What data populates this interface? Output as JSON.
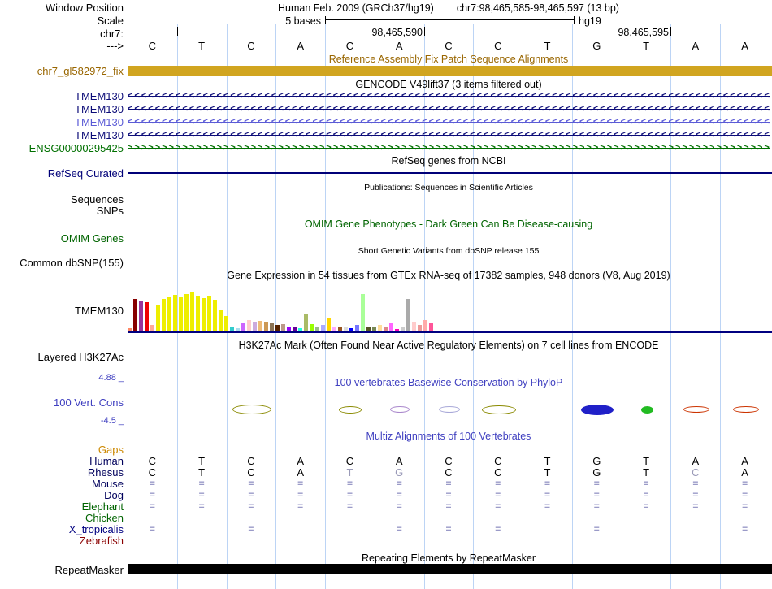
{
  "window": {
    "position_label": "Window Position",
    "assembly_title": "Human Feb. 2009 (GRCh37/hg19)",
    "position_title": "chr7:98,465,585-98,465,597 (13 bp)"
  },
  "ruler": {
    "scale_label": "Scale",
    "scale_text": "5 bases",
    "genome_build": "hg19",
    "chrom_label": "chr7:",
    "coord_ticks": [
      "98,465,590",
      "98,465,595"
    ],
    "strand_arrow": "--->",
    "bases": [
      "C",
      "T",
      "C",
      "A",
      "C",
      "A",
      "C",
      "C",
      "T",
      "G",
      "T",
      "A",
      "A"
    ]
  },
  "grid_color": "#bcd4f5",
  "tracks": {
    "fix_patch": {
      "header": "Reference Assembly Fix Patch Sequence Alignments",
      "label": "chr7_gl582972_fix",
      "bar_color": "#d1a520",
      "text_color": "#996600"
    },
    "gencode": {
      "header": "GENCODE V49lift37 (3 items filtered out)",
      "items": [
        {
          "label": "TMEM130",
          "color": "#0c0c78",
          "arrow": "<"
        },
        {
          "label": "TMEM130",
          "color": "#0c0c78",
          "arrow": "<"
        },
        {
          "label": "TMEM130",
          "color": "#5b5bd6",
          "arrow": "<"
        },
        {
          "label": "TMEM130",
          "color": "#0c0c78",
          "arrow": "<"
        },
        {
          "label": "ENSG00000295425",
          "color": "#007000",
          "arrow": ">"
        }
      ]
    },
    "refseq": {
      "header": "RefSeq genes from NCBI",
      "label": "RefSeq Curated",
      "color": "#000078"
    },
    "publications": {
      "header": "Publications: Sequences in Scientific Articles",
      "labels": [
        "Sequences",
        "SNPs"
      ]
    },
    "omim": {
      "header": "OMIM Gene Phenotypes - Dark Green Can Be Disease-causing",
      "label": "OMIM Genes",
      "color": "#006400"
    },
    "dbsnp": {
      "header": "Short Genetic Variants from dbSNP release 155",
      "label": "Common dbSNP(155)"
    },
    "gtex": {
      "header": "Gene Expression in 54 tissues from GTEx RNA-seq of 17382 samples, 948 donors (V8, Aug 2019)",
      "label": "TMEM130",
      "baseline_color": "#000080"
    },
    "h3k27ac": {
      "header": "H3K27Ac Mark (Often Found Near Active Regulatory Elements) on 7 cell lines from ENCODE",
      "label": "Layered H3K27Ac"
    },
    "phylop": {
      "header": "100 vertebrates Basewise Conservation by PhyloP",
      "label": "100 Vert. Cons",
      "scale_max": "4.88 _",
      "scale_min": "-4.5 _",
      "accent_color": "#4040c0",
      "marks": [
        {
          "col": 2,
          "w": 46,
          "h": 10,
          "color": "#8a8a00",
          "fill": false
        },
        {
          "col": 4,
          "w": 26,
          "h": 7,
          "color": "#8a8a00",
          "fill": false
        },
        {
          "col": 5,
          "w": 22,
          "h": 6,
          "color": "#aa88cc",
          "fill": false
        },
        {
          "col": 6,
          "w": 24,
          "h": 6,
          "color": "#a8a8d8",
          "fill": false
        },
        {
          "col": 7,
          "w": 40,
          "h": 9,
          "color": "#8a8a00",
          "fill": false
        },
        {
          "col": 9,
          "w": 38,
          "h": 11,
          "color": "#2020c8",
          "fill": true
        },
        {
          "col": 10,
          "w": 13,
          "h": 7,
          "color": "#22bb22",
          "fill": true
        },
        {
          "col": 11,
          "w": 30,
          "h": 6,
          "color": "#cc3300",
          "fill": false
        },
        {
          "col": 12,
          "w": 30,
          "h": 6,
          "color": "#cc3300",
          "fill": false
        }
      ]
    },
    "multiz": {
      "header": "Multiz Alignments of 100 Vertebrates",
      "accent_color": "#4040c0",
      "eq_color": "#9a9ac8",
      "dim_color": "#9a9ab8",
      "rows": [
        {
          "label": "Gaps",
          "label_color": "#cc8800",
          "cells": [
            "",
            "",
            "",
            "",
            "",
            "",
            "",
            "",
            "",
            "",
            "",
            "",
            ""
          ]
        },
        {
          "label": "Human",
          "label_color": "#00005c",
          "cells": [
            "C",
            "T",
            "C",
            "A",
            "C",
            "A",
            "C",
            "C",
            "T",
            "G",
            "T",
            "A",
            "A"
          ],
          "dim": []
        },
        {
          "label": "Rhesus",
          "label_color": "#00005c",
          "cells": [
            "C",
            "T",
            "C",
            "A",
            "T",
            "G",
            "C",
            "C",
            "T",
            "G",
            "T",
            "C",
            "A"
          ],
          "dim": [
            4,
            5,
            11
          ]
        },
        {
          "label": "Mouse",
          "label_color": "#00005c",
          "cells": [
            "=",
            "=",
            "=",
            "=",
            "=",
            "=",
            "=",
            "=",
            "=",
            "=",
            "=",
            "=",
            "="
          ]
        },
        {
          "label": "Dog",
          "label_color": "#00005c",
          "cells": [
            "=",
            "=",
            "=",
            "=",
            "=",
            "=",
            "=",
            "=",
            "=",
            "=",
            "=",
            "=",
            "="
          ]
        },
        {
          "label": "Elephant",
          "label_color": "#006400",
          "cells": [
            "=",
            "=",
            "=",
            "=",
            "=",
            "=",
            "=",
            "=",
            "=",
            "=",
            "=",
            "=",
            "="
          ]
        },
        {
          "label": "Chicken",
          "label_color": "#006400",
          "cells": [
            "",
            "",
            "",
            "",
            "",
            "",
            "",
            "",
            "",
            "",
            "",
            "",
            ""
          ]
        },
        {
          "label": "X_tropicalis",
          "label_color": "#000080",
          "cells": [
            "=",
            "",
            "=",
            "",
            "",
            "=",
            "=",
            "=",
            "",
            "=",
            "",
            "",
            "="
          ]
        },
        {
          "label": "Zebrafish",
          "label_color": "#8b0000",
          "cells": [
            "",
            "",
            "",
            "",
            "",
            "",
            "",
            "",
            "",
            "",
            "",
            "",
            ""
          ]
        }
      ]
    },
    "repeatmasker": {
      "header": "Repeating Elements by RepeatMasker",
      "label": "RepeatMasker",
      "bar_color": "#000000"
    }
  },
  "chart_data": {
    "type": "bar",
    "title": "Gene Expression in 54 tissues from GTEx RNA-seq of 17382 samples, 948 donors (V8, Aug 2019)",
    "gene": "TMEM130",
    "n_tissues": 54,
    "note": "heights are rendered pixel heights; tissue names not visible in screenshot",
    "values": [
      4,
      40,
      38,
      36,
      8,
      33,
      40,
      43,
      45,
      43,
      46,
      48,
      44,
      41,
      44,
      39,
      27,
      19,
      6,
      4,
      10,
      14,
      12,
      13,
      12,
      10,
      8,
      9,
      5,
      5,
      4,
      22,
      9,
      6,
      8,
      16,
      6,
      5,
      6,
      4,
      8,
      46,
      5,
      6,
      8,
      5,
      10,
      3,
      6,
      40,
      12,
      8,
      14,
      10
    ],
    "colors": [
      "#ff8866",
      "#880000",
      "#993399",
      "#ee0000",
      "#ffaa99",
      "#eeee00",
      "#eeee00",
      "#eeee00",
      "#eeee00",
      "#eeee00",
      "#eeee00",
      "#eeee00",
      "#eeee00",
      "#eeee00",
      "#eeee00",
      "#eeee00",
      "#eeee00",
      "#eeee00",
      "#33cccc",
      "#aaddee",
      "#cc66ff",
      "#ffcccc",
      "#ccaadd",
      "#eebb77",
      "#cc9955",
      "#8b7355",
      "#552200",
      "#bb9988",
      "#9900ff",
      "#660099",
      "#22ffdd",
      "#aabb66",
      "#99ff00",
      "#99bb88",
      "#aaaaff",
      "#ffd700",
      "#ffaaff",
      "#995522",
      "#dddddd",
      "#0000ff",
      "#7777ff",
      "#aaff99",
      "#555522",
      "#778855",
      "#ffdd99",
      "#dd8888",
      "#ff66ff",
      "#ff00bb",
      "#cccccc",
      "#aaaaaa",
      "#ffcccc",
      "#ee9999",
      "#ffaaaa",
      "#ff5599"
    ]
  }
}
